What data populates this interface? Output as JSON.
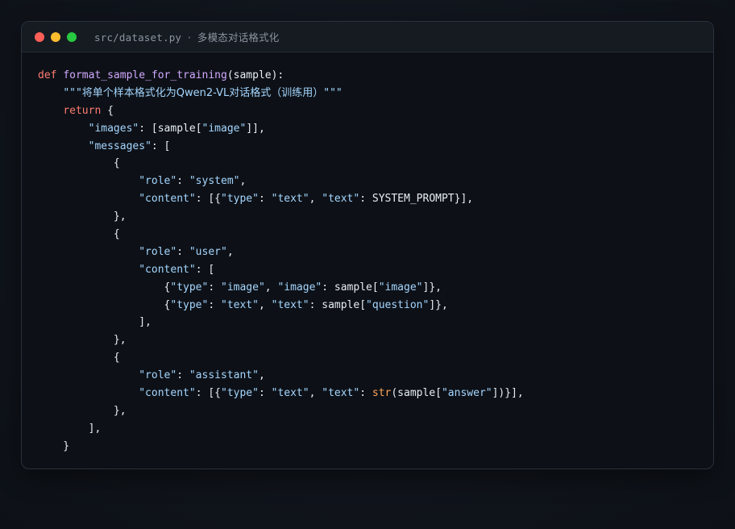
{
  "window": {
    "file_path": "src/dataset.py",
    "separator": "·",
    "subtitle": "多模态对话格式化"
  },
  "code": {
    "func_def_keyword": "def",
    "func_name": "format_sample_for_training",
    "func_params": "(sample):",
    "docstring_open": "\"\"\"",
    "docstring_text": "将单个样本格式化为Qwen2-VL对话格式（训练用）",
    "docstring_close": "\"\"\"",
    "return_keyword": "return",
    "str_images": "\"images\"",
    "str_image": "\"image\"",
    "str_messages": "\"messages\"",
    "str_role": "\"role\"",
    "str_system": "\"system\"",
    "str_content": "\"content\"",
    "str_type": "\"type\"",
    "str_text": "\"text\"",
    "const_system_prompt": "SYSTEM_PROMPT",
    "str_user": "\"user\"",
    "str_question": "\"question\"",
    "str_assistant": "\"assistant\"",
    "builtin_str": "str",
    "str_answer": "\"answer\""
  },
  "colors": {
    "keyword": "#ff7b72",
    "function": "#d2a8ff",
    "string": "#a5d6ff",
    "builtin": "#ffa657",
    "text": "#e6edf3",
    "background": "#0d1117"
  }
}
